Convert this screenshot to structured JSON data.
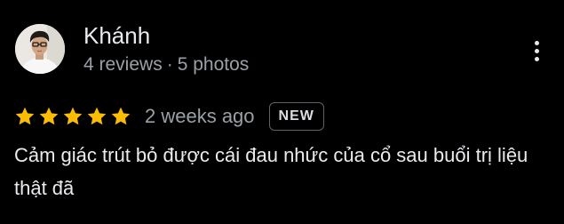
{
  "review": {
    "author": {
      "name": "Khánh",
      "reviews": "4 reviews",
      "separator": "·",
      "photos": "5 photos"
    },
    "rating": 5,
    "rating_max": 5,
    "date": "2 weeks ago",
    "badge": "NEW",
    "text": "Cảm giác trút bỏ được cái đau nhức của cổ sau buổi trị liệu thật đã"
  },
  "icons": {
    "star": "star-icon",
    "more": "more-vert-icon",
    "avatar": "profile-photo"
  },
  "colors": {
    "background": "#000000",
    "star": "#fbbc04",
    "primary_text": "#e8eaed",
    "secondary_text": "#9aa0a6",
    "badge_border": "#5f6368"
  }
}
